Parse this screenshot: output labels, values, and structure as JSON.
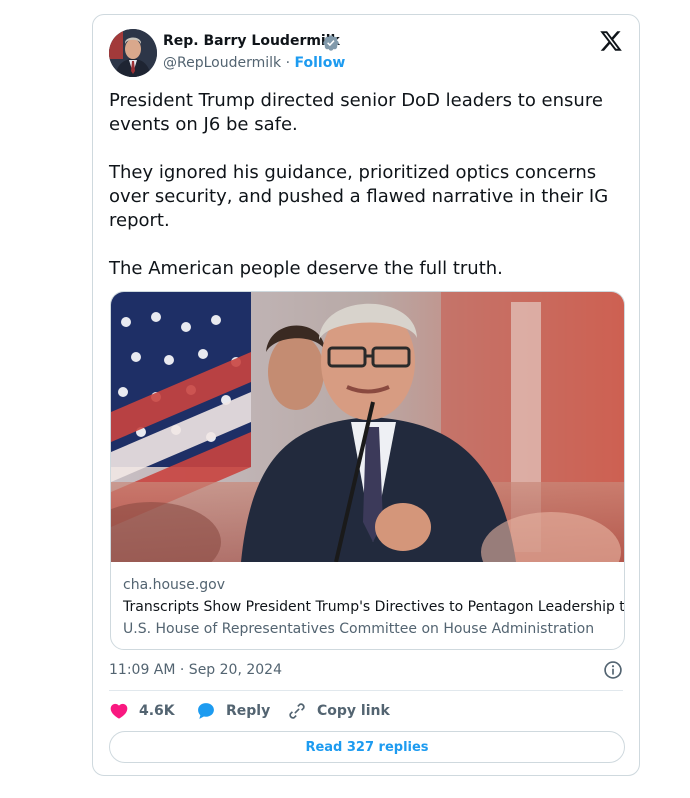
{
  "tweet": {
    "author_name": "Rep. Barry Loudermilk",
    "handle": "@RepLoudermilk",
    "separator": "·",
    "follow_label": "Follow",
    "text": "President Trump directed senior DoD leaders to ensure events on J6 be safe.\n\nThey ignored his guidance, prioritized optics concerns over security, and pushed a flawed narrative in their IG report.\n\nThe American people deserve the full truth.",
    "timestamp": "11:09 AM · Sep 20, 2024"
  },
  "link_card": {
    "domain": "cha.house.gov",
    "title": "Transcripts Show President Trump's Directives to Pentagon Leadership to",
    "description": "U.S. House of Representatives Committee on House Administration"
  },
  "actions": {
    "likes": "4.6K",
    "reply_label": "Reply",
    "copy_link_label": "Copy link",
    "read_replies": "Read 327 replies"
  },
  "colors": {
    "accent": "#1d9bf0",
    "like": "#f91880",
    "secondary_text": "#536471"
  },
  "icons": [
    "verified-badge-icon",
    "x-logo-icon",
    "info-icon",
    "heart-icon",
    "reply-bubble-icon",
    "link-icon"
  ]
}
